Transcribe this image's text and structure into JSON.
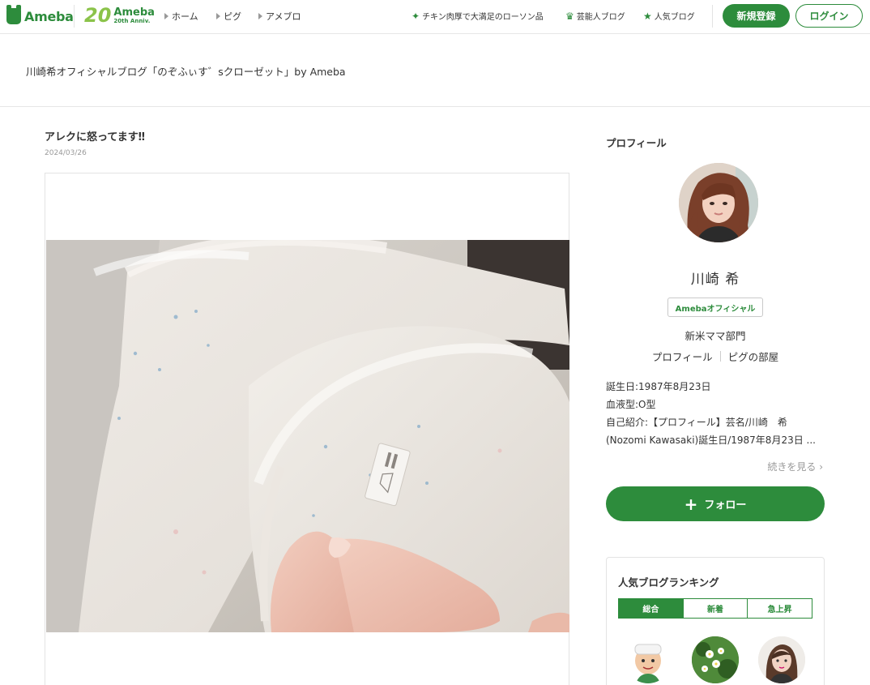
{
  "header": {
    "logo": "Ameba",
    "anniversary_number": "20",
    "anniversary_title": "Ameba",
    "anniversary_sub": "20th Anniv.",
    "nav": [
      {
        "label": "ホーム"
      },
      {
        "label": "ピグ"
      },
      {
        "label": "アメブロ"
      }
    ],
    "promo_links": [
      {
        "label": "チキン肉厚で大満足のローソン品",
        "icon": "sparkle-icon"
      },
      {
        "label": "芸能人ブログ",
        "icon": "crown-icon"
      },
      {
        "label": "人気ブログ",
        "icon": "star-icon"
      }
    ],
    "register_label": "新規登録",
    "login_label": "ログイン"
  },
  "blog": {
    "title": "川崎希オフィシャルブログ「のぞふぃす゛sクローゼット」by Ameba"
  },
  "entry": {
    "title": "アレクに怒ってます‼",
    "date": "2024/03/26",
    "image_alt": "HERMES towel"
  },
  "sidebar": {
    "heading": "プロフィール",
    "name": "川崎 希",
    "badge": "Amebaオフィシャル",
    "genre": "新米ママ部門",
    "links": [
      "プロフィール",
      "ピグの部屋"
    ],
    "info": [
      "誕生日:1987年8月23日",
      "血液型:O型",
      "自己紹介:【プロフィール】芸名/川崎　希(Nozomi Kawasaki)誕生日/1987年8月23日 ..."
    ],
    "more_label": "続きを見る",
    "follow_label": "フォロー"
  },
  "ranking": {
    "title": "人気ブログランキング",
    "tabs": [
      "総合",
      "新着",
      "急上昇"
    ],
    "active_tab": "総合"
  },
  "colors": {
    "accent": "#2d8c3c",
    "border": "#e3e3e3",
    "muted": "#999999"
  }
}
